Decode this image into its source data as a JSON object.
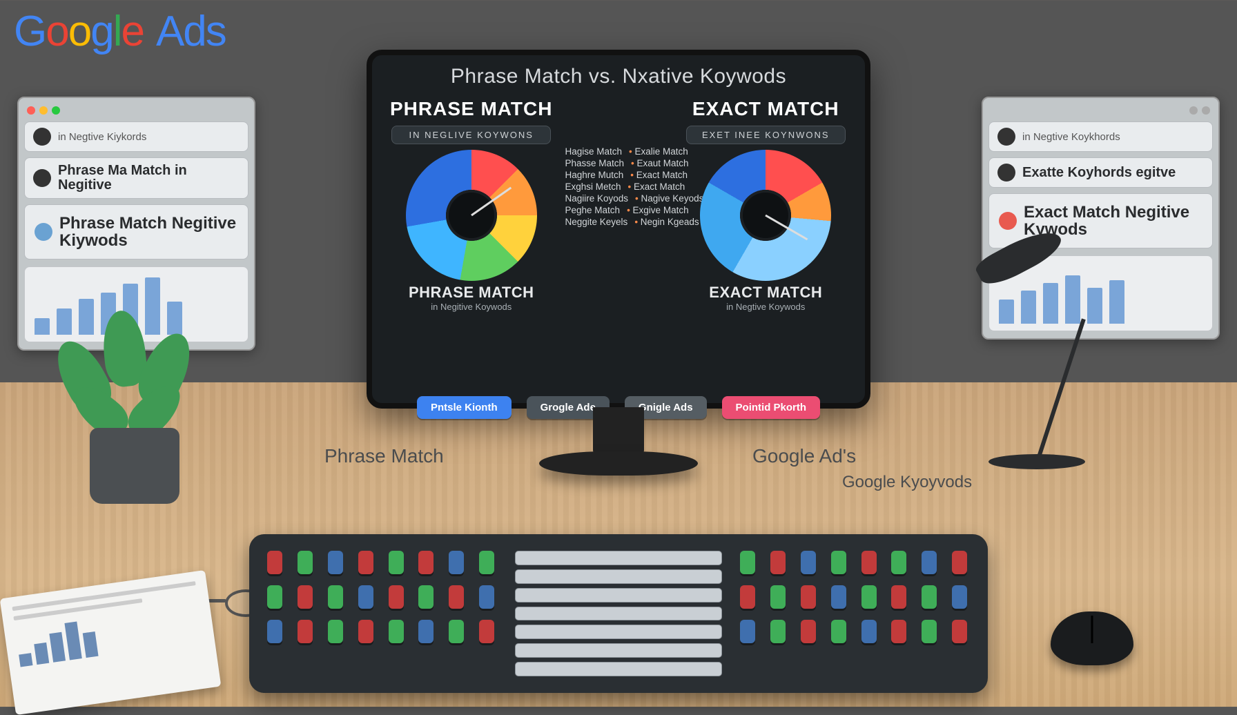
{
  "logo": {
    "word1": "Google",
    "word2": "Ads"
  },
  "leftPanel": {
    "titlebar": "",
    "rows": [
      {
        "icon": "dark",
        "text": "in Negtive Kiykords"
      },
      {
        "icon": "dark",
        "text": "Phrase Ma Match in Negitive"
      },
      {
        "icon": "blue",
        "text": "Phrase Match Negitive Kiywods"
      }
    ],
    "bars": [
      28,
      44,
      60,
      70,
      85,
      95,
      55
    ]
  },
  "rightPanel": {
    "titlebar": "",
    "rows": [
      {
        "icon": "dark",
        "text": "in Negtive Koykhords"
      },
      {
        "icon": "dark",
        "text": "Exatte Koyhords egitve"
      },
      {
        "icon": "red",
        "text": "Exact Match Negitive Kywods"
      }
    ],
    "bars": [
      40,
      55,
      68,
      80,
      60,
      72
    ]
  },
  "monitor": {
    "title": "Phrase Match vs. Nxative Koywods",
    "left": {
      "head": "PHRASE MATCH",
      "sub": "IN  NEGLIVE  KOYWONS",
      "foot1": "PHRASE MATCH",
      "foot2": "in Negitive Koywods"
    },
    "right": {
      "head": "EXACT MATCH",
      "sub": "EXET INEE  KOYNWONS",
      "foot1": "EXACT MATCH",
      "foot2": "in Negtive Koywods"
    },
    "centerRows": [
      {
        "l": "Hagise Match",
        "r": "Exalie Match"
      },
      {
        "l": "Phasse Match",
        "r": "Exaut Match"
      },
      {
        "l": "Haghre Mutch",
        "r": "Exact Match"
      },
      {
        "l": "Exghsi Metch",
        "r": "Exact Match"
      },
      {
        "l": "Nagiire Koyods",
        "r": "Nagive Keyods"
      },
      {
        "l": "Peghe Match",
        "r": "Exgive Match"
      },
      {
        "l": "Neggite Keyels",
        "r": "Negin Kgeads"
      }
    ],
    "buttons": {
      "b1": "Pntsle  Kionth",
      "b2": "Grogle Ade",
      "b3": "Gnigle Ads",
      "b4": "Pointid  Pkorth"
    }
  },
  "deskLabels": {
    "l1": "Phrase Match",
    "l2": "Google Ad's",
    "l3": "Google Kyoyvods"
  },
  "board": {
    "chips": [
      "",
      "",
      "",
      "",
      "",
      "",
      ""
    ]
  }
}
